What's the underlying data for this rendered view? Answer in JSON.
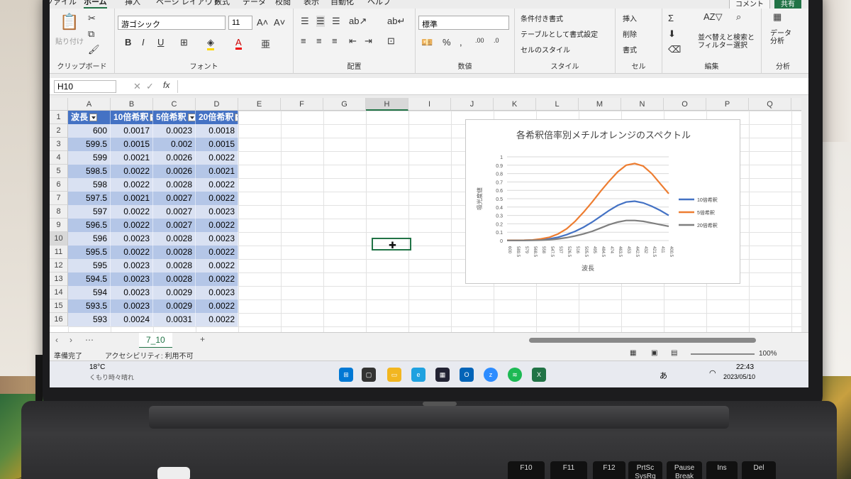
{
  "menu": {
    "tabs": [
      "ファイル",
      "ホーム",
      "挿入",
      "ページ レイアウト",
      "数式",
      "データ",
      "校閲",
      "表示",
      "自動化",
      "ヘルプ"
    ],
    "active": "ホーム",
    "comment": "コメント",
    "share": "共有"
  },
  "ribbon": {
    "clipboard": {
      "paste": "貼り付け",
      "label": "クリップボード"
    },
    "font": {
      "name": "游ゴシック",
      "size": "11",
      "label": "フォント"
    },
    "alignment": {
      "label": "配置"
    },
    "number": {
      "format": "標準",
      "label": "数値"
    },
    "styles": {
      "conditional": "条件付き書式",
      "table": "テーブルとして書式設定",
      "cell": "セルのスタイル",
      "label": "スタイル"
    },
    "cells": {
      "insert": "挿入",
      "delete": "削除",
      "format": "書式",
      "label": "セル"
    },
    "editing": {
      "sort": "並べ替えと\nフィルター",
      "find": "検索と\n選択",
      "label": "編集"
    },
    "analysis": {
      "data": "データ\n分析",
      "label": "分析"
    }
  },
  "formula": {
    "name_box": "H10",
    "fx": "fx"
  },
  "columns": [
    "A",
    "B",
    "C",
    "D",
    "E",
    "F",
    "G",
    "H",
    "I",
    "J",
    "K",
    "L",
    "M",
    "N",
    "O",
    "P",
    "Q",
    "R"
  ],
  "selected_column": "H",
  "selected_row": "10",
  "table": {
    "headers": [
      "波長",
      "10倍希釈",
      "5倍希釈",
      "20倍希釈"
    ],
    "rows": [
      [
        "1",
        "",
        "",
        "",
        ""
      ],
      [
        "2",
        "600",
        "0.0017",
        "0.0023",
        "0.0018"
      ],
      [
        "3",
        "599.5",
        "0.0015",
        "0.002",
        "0.0015"
      ],
      [
        "4",
        "599",
        "0.0021",
        "0.0026",
        "0.0022"
      ],
      [
        "5",
        "598.5",
        "0.0022",
        "0.0026",
        "0.0021"
      ],
      [
        "6",
        "598",
        "0.0022",
        "0.0028",
        "0.0022"
      ],
      [
        "7",
        "597.5",
        "0.0021",
        "0.0027",
        "0.0022"
      ],
      [
        "8",
        "597",
        "0.0022",
        "0.0027",
        "0.0023"
      ],
      [
        "9",
        "596.5",
        "0.0022",
        "0.0027",
        "0.0022"
      ],
      [
        "10",
        "596",
        "0.0023",
        "0.0028",
        "0.0023"
      ],
      [
        "11",
        "595.5",
        "0.0022",
        "0.0028",
        "0.0022"
      ],
      [
        "12",
        "595",
        "0.0023",
        "0.0028",
        "0.0022"
      ],
      [
        "13",
        "594.5",
        "0.0023",
        "0.0028",
        "0.0022"
      ],
      [
        "14",
        "594",
        "0.0023",
        "0.0029",
        "0.0023"
      ],
      [
        "15",
        "593.5",
        "0.0023",
        "0.0029",
        "0.0022"
      ],
      [
        "16",
        "593",
        "0.0024",
        "0.0031",
        "0.0022"
      ]
    ]
  },
  "chart_data": {
    "type": "line",
    "title": "各希釈倍率別メチルオレンジのスペクトル",
    "xlabel": "波長",
    "ylabel": "吸光度値",
    "ylim": [
      0,
      1
    ],
    "yticks": [
      "0",
      "0.1",
      "0.2",
      "0.3",
      "0.4",
      "0.5",
      "0.6",
      "0.7",
      "0.8",
      "0.9",
      "1"
    ],
    "x": [
      "600",
      "589.5",
      "579",
      "568.5",
      "558",
      "547.5",
      "537",
      "526.5",
      "516",
      "505.5",
      "495",
      "484.5",
      "474",
      "463.5",
      "453",
      "442.5",
      "432",
      "421.5",
      "411",
      "400.5"
    ],
    "series": [
      {
        "name": "10倍希釈",
        "color": "#4472c4",
        "values": [
          0.002,
          0.002,
          0.003,
          0.005,
          0.01,
          0.02,
          0.04,
          0.07,
          0.11,
          0.16,
          0.22,
          0.29,
          0.36,
          0.42,
          0.46,
          0.47,
          0.45,
          0.41,
          0.36,
          0.3
        ]
      },
      {
        "name": "5倍希釈",
        "color": "#ed7d31",
        "values": [
          0.003,
          0.003,
          0.004,
          0.008,
          0.02,
          0.04,
          0.08,
          0.14,
          0.23,
          0.34,
          0.46,
          0.59,
          0.71,
          0.82,
          0.9,
          0.92,
          0.89,
          0.8,
          0.68,
          0.56
        ]
      },
      {
        "name": "20倍希釈",
        "color": "#7f7f7f",
        "values": [
          0.002,
          0.002,
          0.002,
          0.003,
          0.005,
          0.01,
          0.02,
          0.035,
          0.055,
          0.08,
          0.11,
          0.15,
          0.19,
          0.22,
          0.24,
          0.24,
          0.23,
          0.21,
          0.19,
          0.17
        ]
      }
    ],
    "grid": true,
    "legend": "right"
  },
  "sheet_tab": "7_10",
  "status": {
    "ready": "準備完了",
    "accessibility": "アクセシビリティ: 利用不可",
    "zoom": "100%"
  },
  "taskbar": {
    "weather_temp": "18°C",
    "weather_text": "くもり時々晴れ",
    "time": "22:43",
    "date": "2023/05/10"
  },
  "keys": [
    "F10",
    "F11",
    "F12",
    "PrtSc\nSysRq",
    "Pause\nBreak",
    "Ins",
    "Del"
  ]
}
